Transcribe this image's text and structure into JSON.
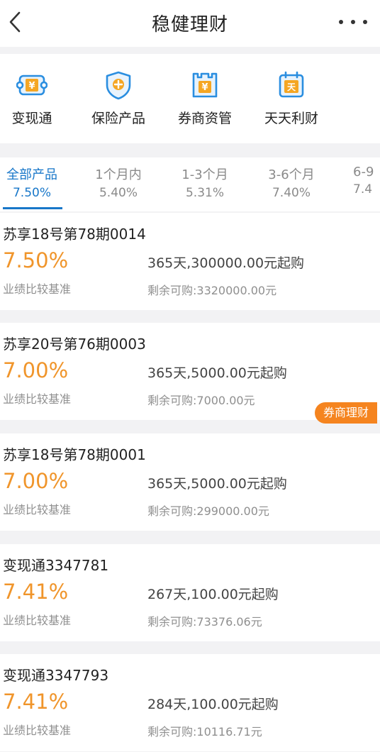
{
  "header": {
    "title": "稳健理财"
  },
  "shortcuts": [
    {
      "label": "变现通",
      "icon": "ticket-icon"
    },
    {
      "label": "保险产品",
      "icon": "shield-plus-icon"
    },
    {
      "label": "券商资管",
      "icon": "tower-icon"
    },
    {
      "label": "天天利财",
      "icon": "calendar-icon"
    }
  ],
  "tabs": [
    {
      "label": "全部产品",
      "rate": "7.50%"
    },
    {
      "label": "1个月内",
      "rate": "5.40%"
    },
    {
      "label": "1-3个月",
      "rate": "5.31%"
    },
    {
      "label": "3-6个月",
      "rate": "7.40%"
    },
    {
      "label": "6-9",
      "rate": "7.4"
    }
  ],
  "products": [
    {
      "name": "苏享18号第78期0014",
      "rate": "7.50%",
      "rate_label": "业绩比较基准",
      "term": "365天,300000.00元起购",
      "remain": "剩余可购:3320000.00元"
    },
    {
      "name": "苏享20号第76期0003",
      "rate": "7.00%",
      "rate_label": "业绩比较基准",
      "term": "365天,5000.00元起购",
      "remain": "剩余可购:7000.00元",
      "badge": "券商理财"
    },
    {
      "name": "苏享18号第78期0001",
      "rate": "7.00%",
      "rate_label": "业绩比较基准",
      "term": "365天,5000.00元起购",
      "remain": "剩余可购:299000.00元"
    },
    {
      "name": "变现通3347781",
      "rate": "7.41%",
      "rate_label": "业绩比较基准",
      "term": "267天,100.00元起购",
      "remain": "剩余可购:73376.06元"
    },
    {
      "name": "变现通3347793",
      "rate": "7.41%",
      "rate_label": "业绩比较基准",
      "term": "284天,100.00元起购",
      "remain": "剩余可购:10116.71元"
    }
  ],
  "colors": {
    "accent": "#1877c9",
    "rate": "#f0952b",
    "badge": "#f5841f"
  }
}
